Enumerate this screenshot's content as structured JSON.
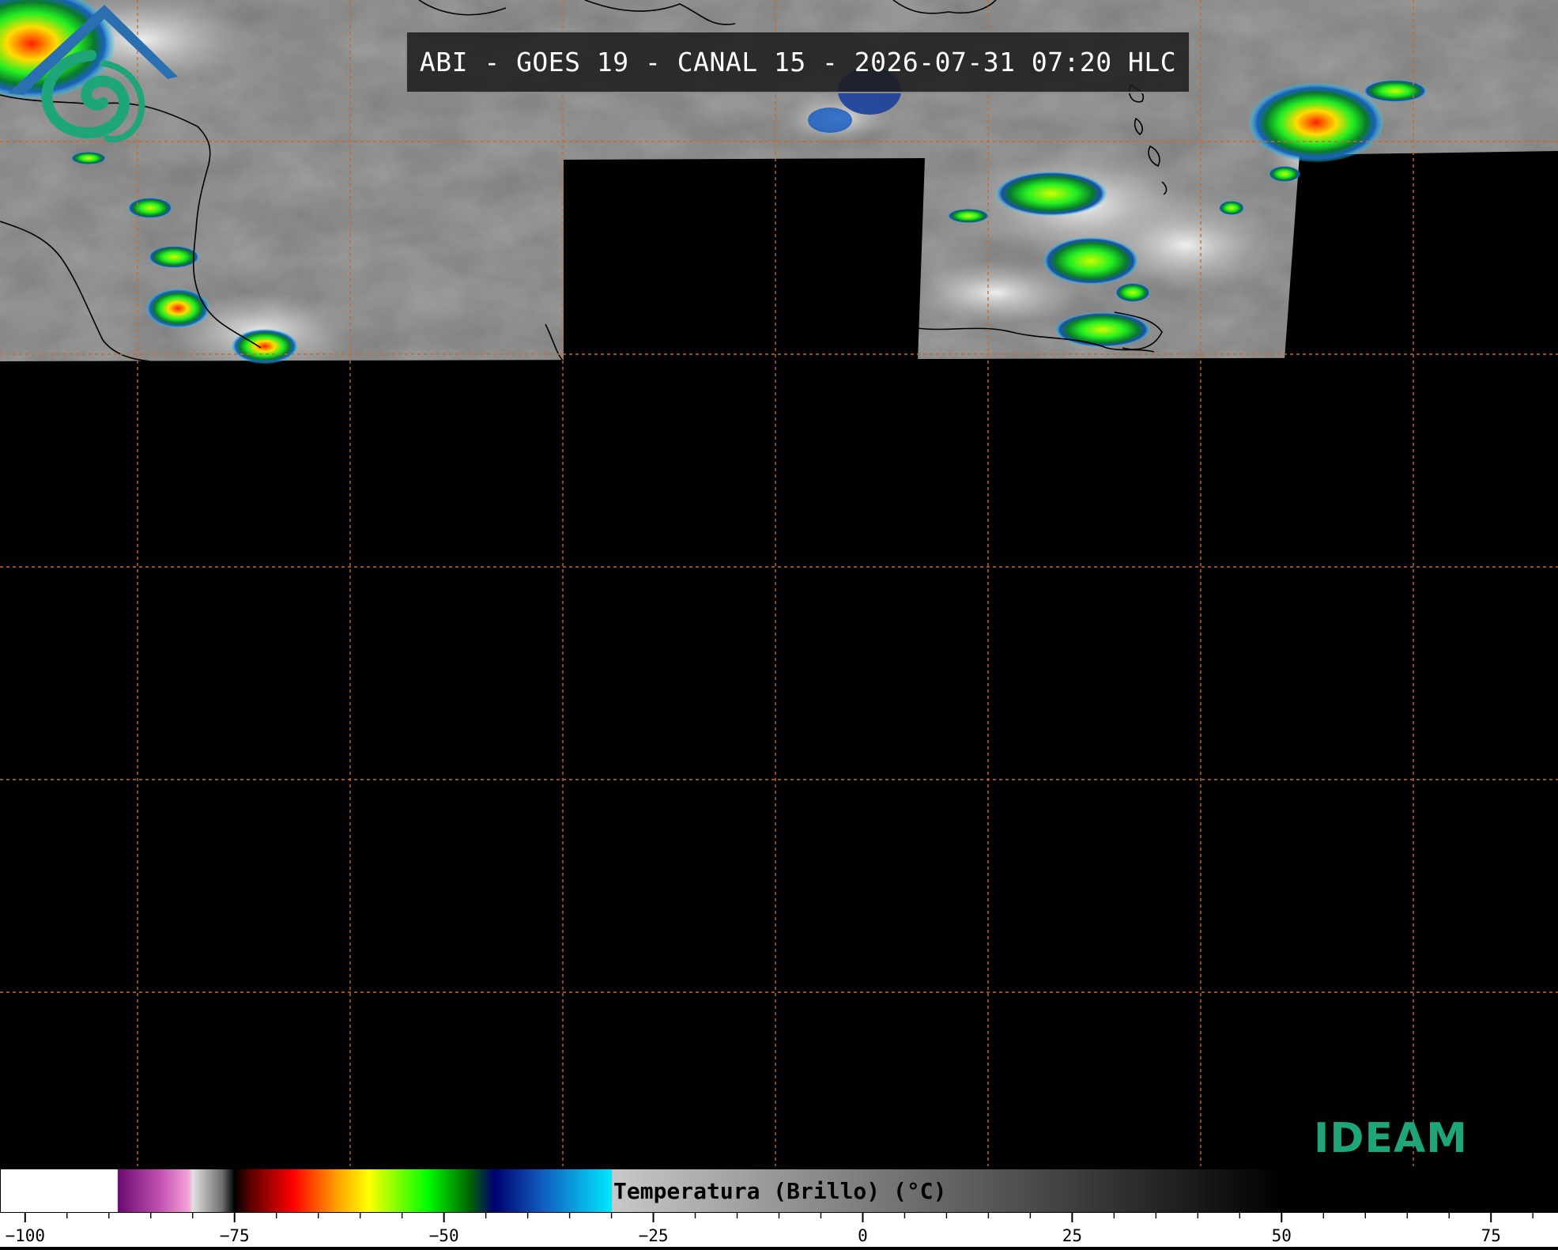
{
  "header": {
    "title": "ABI - GOES 19 - CANAL 15 - 2026-07-31 07:20 HLC"
  },
  "logo": {
    "text": "IDEAM",
    "colors": {
      "roof": "#2a6fb0",
      "swirl": "#1fa57a"
    }
  },
  "colorbar": {
    "label": "Temperatura (Brillo) (°C)",
    "min": -103,
    "max": 83,
    "ticks": [
      {
        "value": -100,
        "label": "−100"
      },
      {
        "value": -75,
        "label": "−75"
      },
      {
        "value": -50,
        "label": "−50"
      },
      {
        "value": -25,
        "label": "−25"
      },
      {
        "value": 0,
        "label": "0"
      },
      {
        "value": 25,
        "label": "25"
      },
      {
        "value": 50,
        "label": "50"
      },
      {
        "value": 75,
        "label": "75"
      }
    ],
    "minor_step": 5,
    "stops": [
      {
        "value": -103,
        "color": "#ffffff"
      },
      {
        "value": -89,
        "color": "#ffffff"
      },
      {
        "value": -88.9,
        "color": "#6a0a70"
      },
      {
        "value": -84,
        "color": "#c04fb0"
      },
      {
        "value": -80.5,
        "color": "#f4a0d8"
      },
      {
        "value": -80,
        "color": "#e0e0e0"
      },
      {
        "value": -76.5,
        "color": "#707070"
      },
      {
        "value": -75,
        "color": "#000000"
      },
      {
        "value": -73,
        "color": "#600000"
      },
      {
        "value": -68,
        "color": "#ff0000"
      },
      {
        "value": -63,
        "color": "#ff9900"
      },
      {
        "value": -59,
        "color": "#ffff00"
      },
      {
        "value": -52,
        "color": "#00ff00"
      },
      {
        "value": -47,
        "color": "#006600"
      },
      {
        "value": -44,
        "color": "#000070"
      },
      {
        "value": -38,
        "color": "#1060c0"
      },
      {
        "value": -30,
        "color": "#00e8ff"
      },
      {
        "value": -29.9,
        "color": "#c8c8c8"
      },
      {
        "value": 50,
        "color": "#000000"
      },
      {
        "value": 83,
        "color": "#000000"
      }
    ]
  },
  "map": {
    "grid_color": "#c86a2a",
    "land_outline_color": "#000000",
    "background": "#000000"
  }
}
